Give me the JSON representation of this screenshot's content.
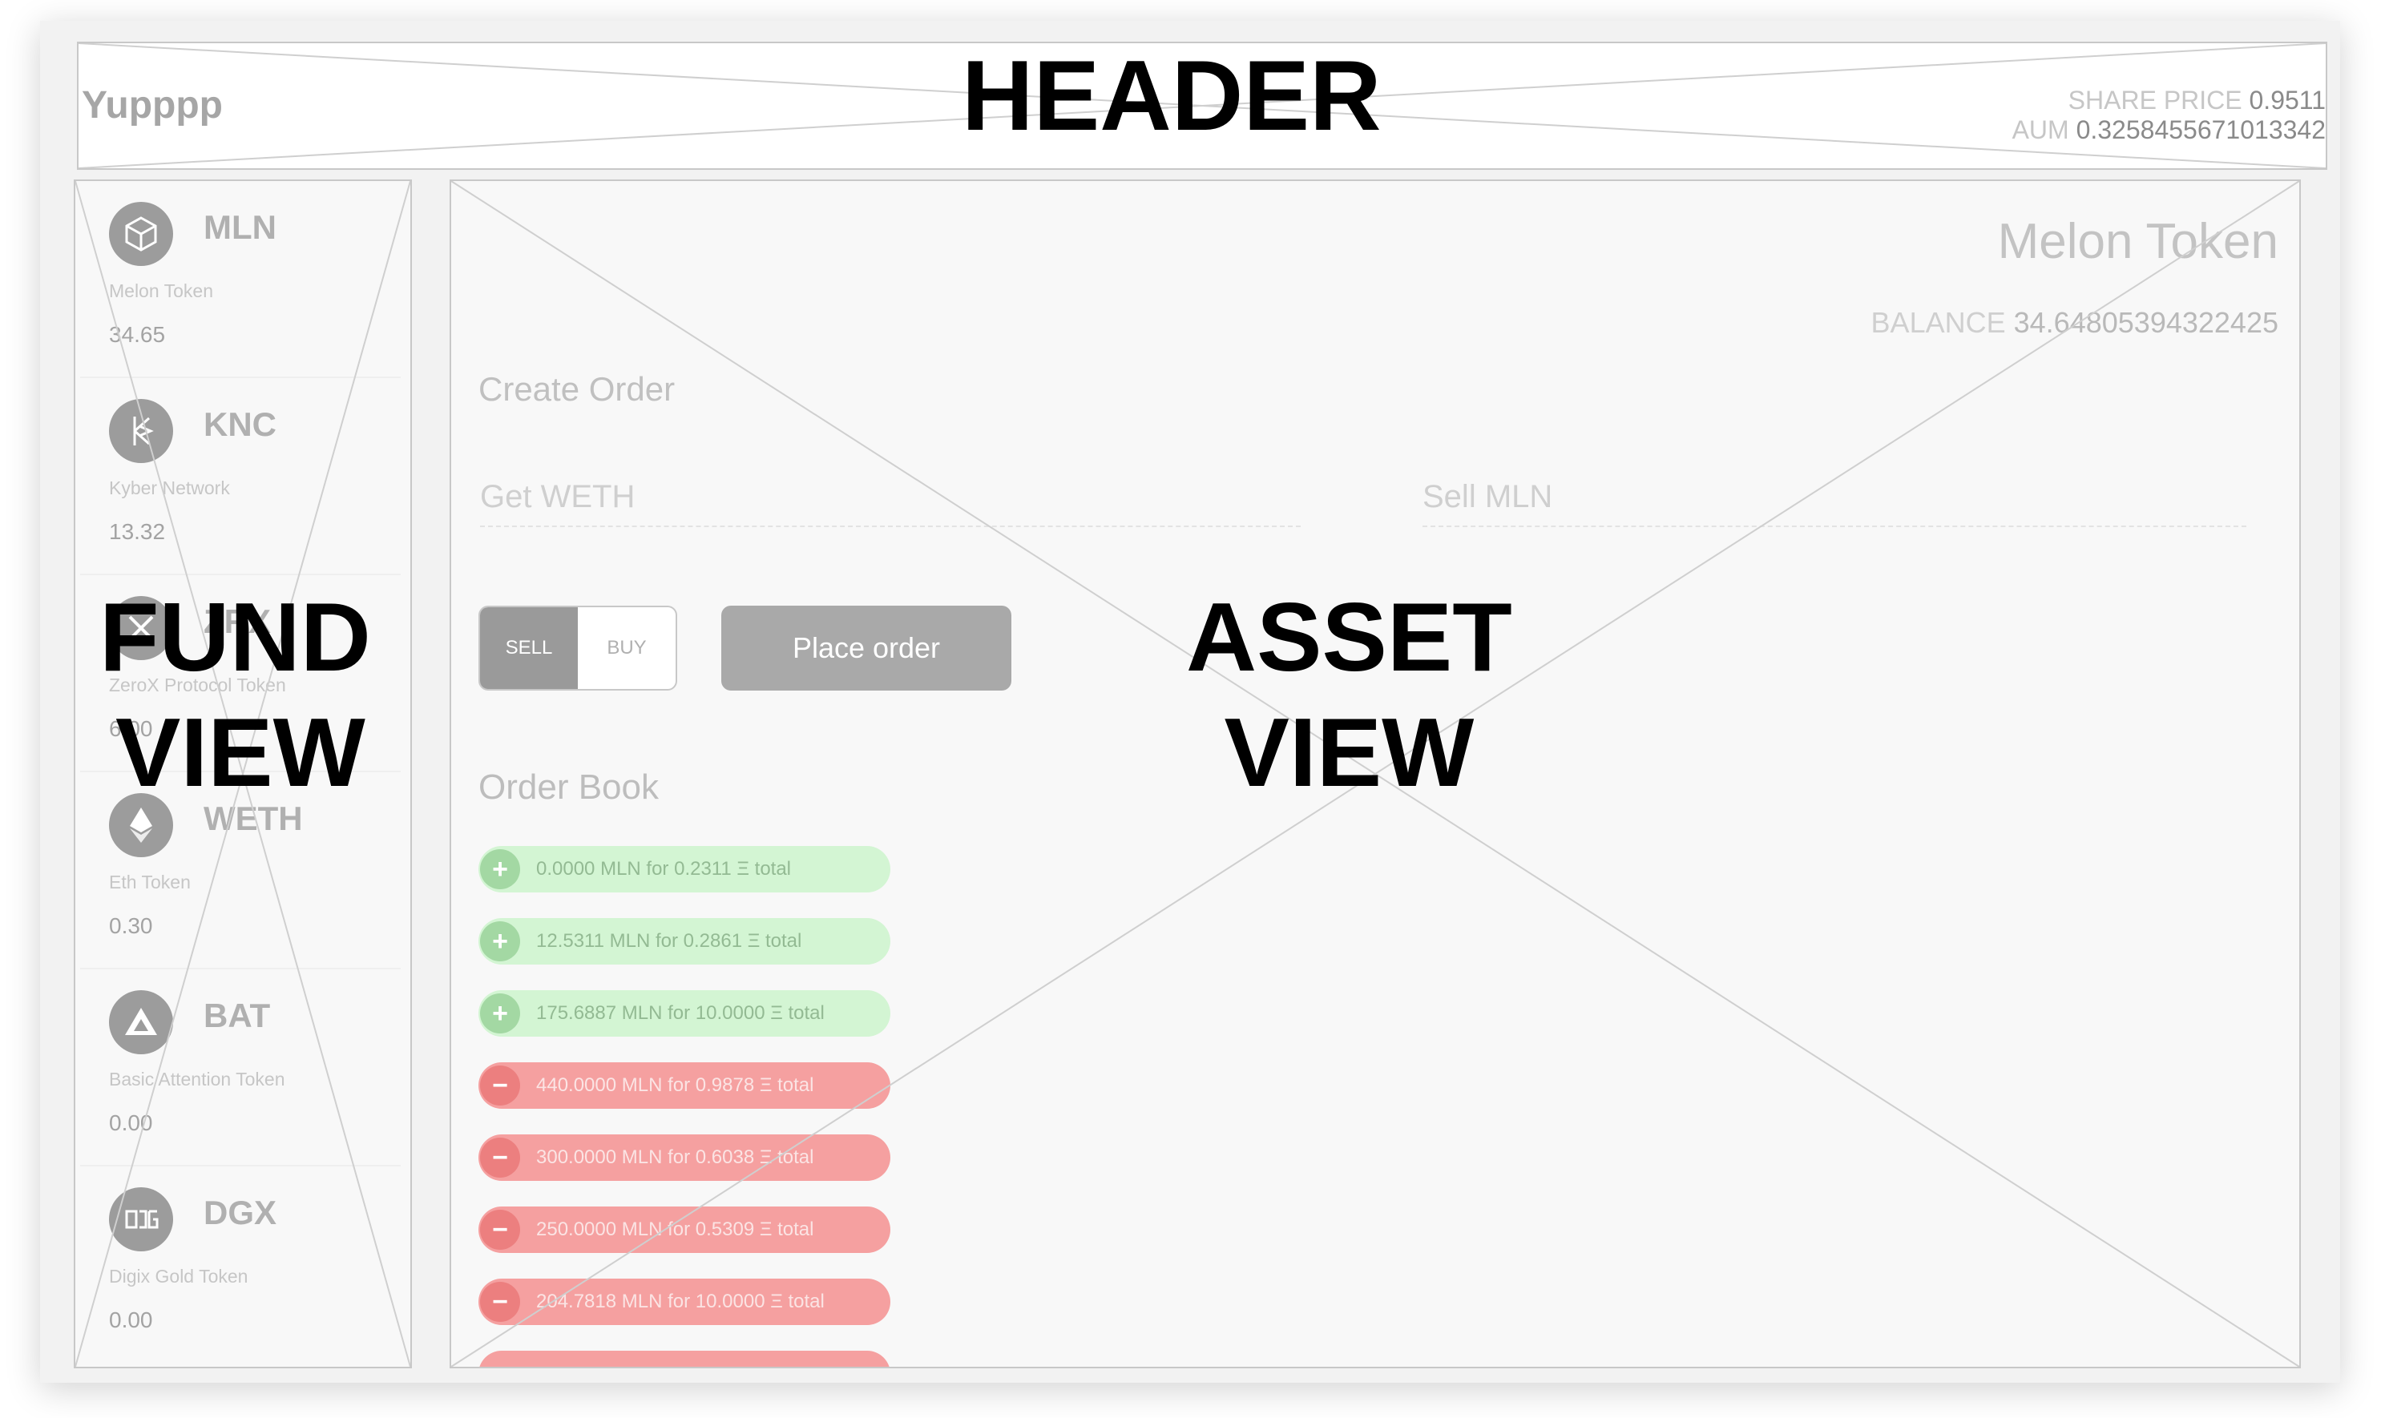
{
  "overlay_labels": {
    "header": "HEADER",
    "fund_view_line1": "FUND",
    "fund_view_line2": "VIEW",
    "asset_view_line1": "ASSET",
    "asset_view_line2": "VIEW"
  },
  "header": {
    "fund_name": "Yupppp",
    "share_price_label": "SHARE PRICE",
    "share_price_value": "0.9511",
    "aum_label": "AUM",
    "aum_value": "0.3258455671013342"
  },
  "sidebar": {
    "assets": [
      {
        "symbol": "MLN",
        "name": "Melon Token",
        "balance": "34.65",
        "icon": "melon-cube-icon"
      },
      {
        "symbol": "KNC",
        "name": "Kyber Network",
        "balance": "13.32",
        "icon": "kyber-icon"
      },
      {
        "symbol": "ZRX",
        "name": "ZeroX Protocol Token",
        "balance": "6.00",
        "icon": "zrx-icon"
      },
      {
        "symbol": "WETH",
        "name": "Eth Token",
        "balance": "0.30",
        "icon": "ethereum-icon"
      },
      {
        "symbol": "BAT",
        "name": "Basic Attention Token",
        "balance": "0.00",
        "icon": "bat-triangle-icon"
      },
      {
        "symbol": "DGX",
        "name": "Digix Gold Token",
        "balance": "0.00",
        "icon": "dgx-icon"
      }
    ]
  },
  "asset_view": {
    "token_title": "Melon Token",
    "balance_label": "BALANCE",
    "balance_value": "34.64805394322425",
    "create_order_title": "Create Order",
    "get_placeholder": "Get WETH",
    "sell_placeholder": "Sell MLN",
    "toggle_sell": "SELL",
    "toggle_buy": "BUY",
    "place_order": "Place order",
    "order_book_title": "Order Book",
    "orders": [
      {
        "side": "buy",
        "text": "0.0000 MLN for 0.2311 Ξ total"
      },
      {
        "side": "buy",
        "text": "12.5311 MLN for 0.2861 Ξ total"
      },
      {
        "side": "buy",
        "text": "175.6887 MLN for 10.0000 Ξ total"
      },
      {
        "side": "sell",
        "text": "440.0000 MLN for 0.9878 Ξ total"
      },
      {
        "side": "sell",
        "text": "300.0000 MLN for 0.6038 Ξ total"
      },
      {
        "side": "sell",
        "text": "250.0000 MLN for 0.5309 Ξ total"
      },
      {
        "side": "sell",
        "text": "204.7818 MLN for 10.0000 Ξ total"
      }
    ]
  },
  "colors": {
    "buy_order_bg": "#d3f5d3",
    "sell_order_bg": "#f5a0a0",
    "wireframe_gray": "#c8c8c8"
  }
}
